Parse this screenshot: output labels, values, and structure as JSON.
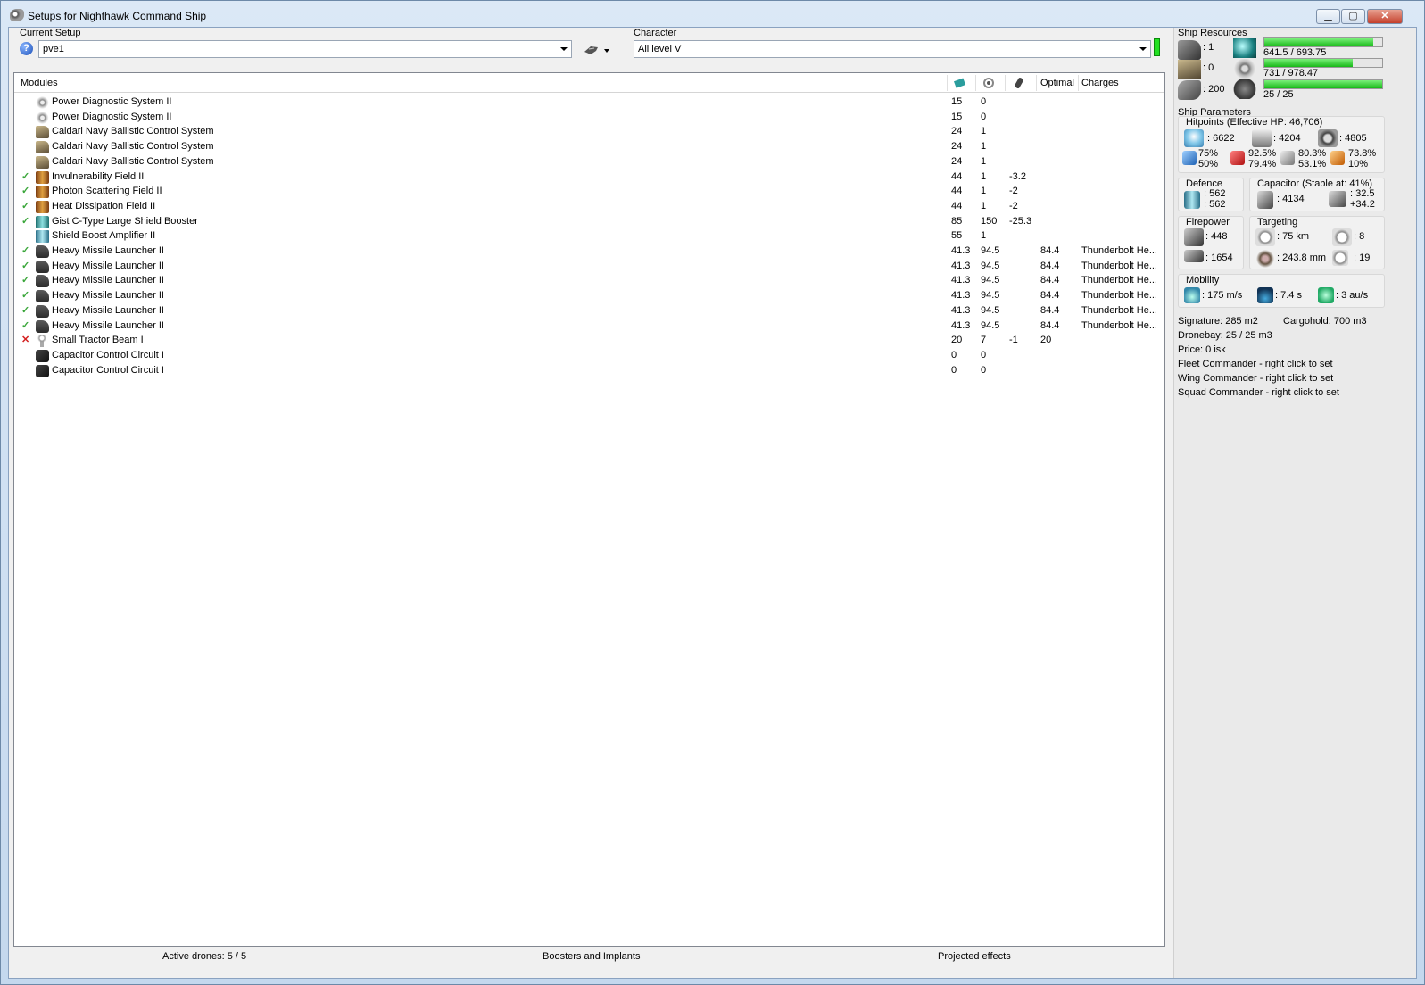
{
  "window": {
    "title": "Setups for Nighthawk Command Ship",
    "minimize": "▁",
    "maximize": "▢",
    "close": "✕"
  },
  "setup": {
    "label": "Current Setup",
    "value": "pve1"
  },
  "character": {
    "label": "Character",
    "value": "All level V"
  },
  "modules": {
    "headers": {
      "name": "Modules",
      "cpu_icon": "cpu-icon",
      "pg_icon": "powergrid-icon",
      "cap_icon": "capacitor-icon",
      "optimal": "Optimal",
      "charges": "Charges"
    },
    "rows": [
      {
        "state": "",
        "icon": "ic-pds",
        "name": "Power Diagnostic System II",
        "cpu": "15",
        "pg": "0",
        "cap": "",
        "optimal": "",
        "charges": ""
      },
      {
        "state": "",
        "icon": "ic-pds",
        "name": "Power Diagnostic System II",
        "cpu": "15",
        "pg": "0",
        "cap": "",
        "optimal": "",
        "charges": ""
      },
      {
        "state": "",
        "icon": "ic-bcs",
        "name": "Caldari Navy Ballistic Control System",
        "cpu": "24",
        "pg": "1",
        "cap": "",
        "optimal": "",
        "charges": ""
      },
      {
        "state": "",
        "icon": "ic-bcs",
        "name": "Caldari Navy Ballistic Control System",
        "cpu": "24",
        "pg": "1",
        "cap": "",
        "optimal": "",
        "charges": ""
      },
      {
        "state": "",
        "icon": "ic-bcs",
        "name": "Caldari Navy Ballistic Control System",
        "cpu": "24",
        "pg": "1",
        "cap": "",
        "optimal": "",
        "charges": ""
      },
      {
        "state": "on",
        "icon": "ic-field",
        "name": "Invulnerability Field II",
        "cpu": "44",
        "pg": "1",
        "cap": "-3.2",
        "optimal": "",
        "charges": ""
      },
      {
        "state": "on",
        "icon": "ic-field",
        "name": "Photon Scattering Field II",
        "cpu": "44",
        "pg": "1",
        "cap": "-2",
        "optimal": "",
        "charges": ""
      },
      {
        "state": "on",
        "icon": "ic-field",
        "name": "Heat Dissipation Field II",
        "cpu": "44",
        "pg": "1",
        "cap": "-2",
        "optimal": "",
        "charges": ""
      },
      {
        "state": "on",
        "icon": "ic-booster",
        "name": "Gist C-Type Large Shield Booster",
        "cpu": "85",
        "pg": "150",
        "cap": "-25.3",
        "optimal": "",
        "charges": ""
      },
      {
        "state": "",
        "icon": "ic-amp",
        "name": "Shield Boost Amplifier II",
        "cpu": "55",
        "pg": "1",
        "cap": "",
        "optimal": "",
        "charges": ""
      },
      {
        "state": "on",
        "icon": "ic-hml",
        "name": "Heavy Missile Launcher II",
        "cpu": "41.3",
        "pg": "94.5",
        "cap": "",
        "optimal": "84.4",
        "charges": "Thunderbolt He..."
      },
      {
        "state": "on",
        "icon": "ic-hml",
        "name": "Heavy Missile Launcher II",
        "cpu": "41.3",
        "pg": "94.5",
        "cap": "",
        "optimal": "84.4",
        "charges": "Thunderbolt He..."
      },
      {
        "state": "on",
        "icon": "ic-hml",
        "name": "Heavy Missile Launcher II",
        "cpu": "41.3",
        "pg": "94.5",
        "cap": "",
        "optimal": "84.4",
        "charges": "Thunderbolt He..."
      },
      {
        "state": "on",
        "icon": "ic-hml",
        "name": "Heavy Missile Launcher II",
        "cpu": "41.3",
        "pg": "94.5",
        "cap": "",
        "optimal": "84.4",
        "charges": "Thunderbolt He..."
      },
      {
        "state": "on",
        "icon": "ic-hml",
        "name": "Heavy Missile Launcher II",
        "cpu": "41.3",
        "pg": "94.5",
        "cap": "",
        "optimal": "84.4",
        "charges": "Thunderbolt He..."
      },
      {
        "state": "on",
        "icon": "ic-hml",
        "name": "Heavy Missile Launcher II",
        "cpu": "41.3",
        "pg": "94.5",
        "cap": "",
        "optimal": "84.4",
        "charges": "Thunderbolt He..."
      },
      {
        "state": "off",
        "icon": "ic-tractor",
        "name": "Small Tractor Beam I",
        "cpu": "20",
        "pg": "7",
        "cap": "-1",
        "optimal": "20",
        "charges": ""
      },
      {
        "state": "",
        "icon": "ic-ccc",
        "name": "Capacitor Control Circuit I",
        "cpu": "0",
        "pg": "0",
        "cap": "",
        "optimal": "",
        "charges": ""
      },
      {
        "state": "",
        "icon": "ic-ccc",
        "name": "Capacitor Control Circuit I",
        "cpu": "0",
        "pg": "0",
        "cap": "",
        "optimal": "",
        "charges": ""
      }
    ]
  },
  "bottom": {
    "drones": "Active drones: 5 / 5",
    "boosters": "Boosters and Implants",
    "projected": "Projected effects"
  },
  "resources": {
    "title": "Ship Resources",
    "turrets": ": 1",
    "launchers": ": 0",
    "calibration": ": 200",
    "cpu": "641.5 / 693.75",
    "cpu_fraction": 0.925,
    "powergrid": "731 / 978.47",
    "powergrid_fraction": 0.747,
    "dronebay": "25 / 25",
    "dronebay_fraction": 1.0
  },
  "parameters": {
    "title": "Ship Parameters",
    "hitpoints_title": "Hitpoints (Effective HP: 46,706)",
    "shield": ": 6622",
    "armor": ": 4204",
    "hull": ": 4805",
    "res_em": "75%\n50%",
    "res_em_1": "75%",
    "res_em_2": "50%",
    "res_therm_1": "92.5%",
    "res_therm_2": "79.4%",
    "res_kin_1": "80.3%",
    "res_kin_2": "53.1%",
    "res_exp_1": "73.8%",
    "res_exp_2": "10%",
    "defence_title": "Defence",
    "defence_1": ": 562",
    "defence_2": ": 562",
    "capacitor_title": "Capacitor (Stable at: 41%)",
    "capacitor": ": 4134",
    "cap_1": ": 32.5",
    "cap_2": "+34.2",
    "firepower_title": "Firepower",
    "firepower_1": ": 448",
    "firepower_2": ": 1654",
    "targeting_title": "Targeting",
    "range": ": 75 km",
    "max_targets": ": 8",
    "scan_res": ": 243.8 mm",
    "sensor": ": 19",
    "mobility_title": "Mobility",
    "speed": ": 175 m/s",
    "align": ": 7.4 s",
    "warp": ": 3 au/s",
    "signature": "Signature: 285 m2",
    "cargohold": "Cargohold: 700 m3",
    "dronebay": "Dronebay: 25 / 25 m3",
    "price": "Price: 0 isk",
    "fleet": "Fleet Commander - right click to set",
    "wing": "Wing Commander - right click to set",
    "squad": "Squad Commander - right click to set"
  }
}
